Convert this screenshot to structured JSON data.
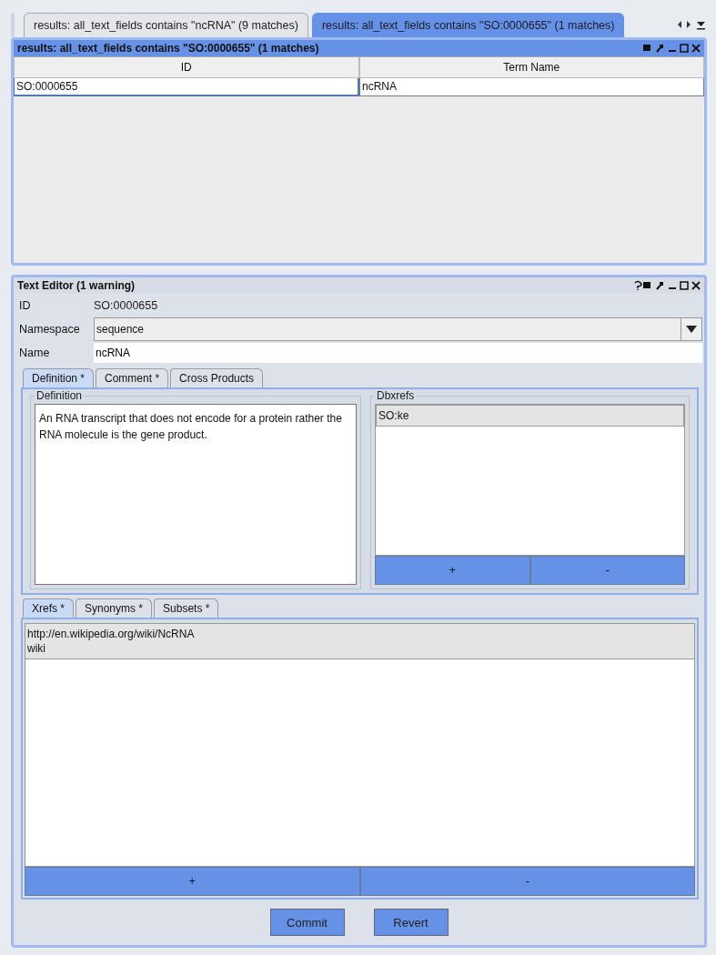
{
  "doc_tabs": [
    {
      "label": "results:  all_text_fields contains \"ncRNA\" (9 matches)",
      "selected": false
    },
    {
      "label": "results:  all_text_fields contains \"SO:0000655\" (1 matches)",
      "selected": true
    }
  ],
  "results": {
    "title": "results: all_text_fields contains \"SO:0000655\" (1 matches)",
    "columns": [
      "ID",
      "Term Name"
    ],
    "rows": [
      [
        "SO:0000655",
        "ncRNA"
      ]
    ]
  },
  "editor": {
    "title": "Text Editor (1 warning)",
    "id_label": "ID",
    "id_value": "SO:0000655",
    "namespace_label": "Namespace",
    "namespace_value": "sequence",
    "name_label": "Name",
    "name_value": "ncRNA",
    "tabs": [
      {
        "label": "Definition *",
        "selected": true
      },
      {
        "label": "Comment *",
        "selected": false
      },
      {
        "label": "Cross Products",
        "selected": false
      }
    ],
    "definition_label": "Definition",
    "definition": "An RNA transcript that does not encode for a protein rather the RNA molecule is the gene product.",
    "dbxrefs_label": "Dbxrefs",
    "dbxrefs": [
      "SO:ke"
    ],
    "add": "+",
    "remove": "-",
    "lower_tabs": [
      {
        "label": "Xrefs *",
        "selected": true
      },
      {
        "label": "Synonyms *",
        "selected": false
      },
      {
        "label": "Subsets *",
        "selected": false
      }
    ],
    "xrefs": [
      {
        "url": "http://en.wikipedia.org/wiki/NcRNA",
        "desc": "wiki"
      }
    ],
    "lower_add": "+",
    "lower_remove": "-",
    "commit": "Commit",
    "revert": "Revert"
  }
}
